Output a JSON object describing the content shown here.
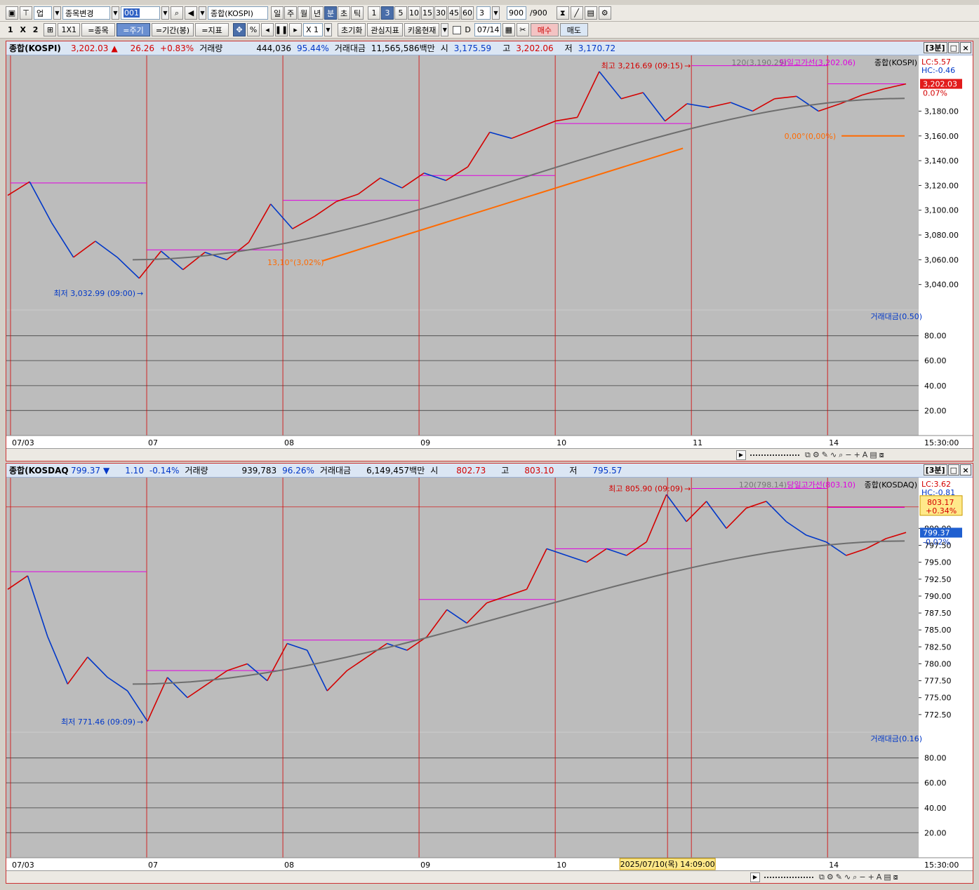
{
  "toolbar1": {
    "gubun": "업",
    "stock_change": "종목변경",
    "code": "001",
    "index_name": "종합(KOSPI)",
    "periods": [
      "일",
      "주",
      "월",
      "년",
      "분",
      "초",
      "틱"
    ],
    "active_period": "분",
    "intervals": [
      "1",
      "3",
      "5",
      "10",
      "15",
      "30",
      "45",
      "60"
    ],
    "active_interval": "3",
    "interval_value": "3",
    "count": "900",
    "count_total": "/900"
  },
  "toolbar2": {
    "layout": "1 X 2",
    "one_by_one": "1X1",
    "item_btn": "=종목",
    "period_btn": "=주기",
    "range_btn": "=기간(봉)",
    "indicator_btn": "=지표",
    "percent": "%",
    "zoom": "X 1",
    "reset": "초기화",
    "interest": "관심지표",
    "kiwoom": "키움현재",
    "date_label": "D",
    "date": "07/14",
    "buy": "매수",
    "sell": "매도"
  },
  "panels": [
    {
      "name": "종합(KOSPI)",
      "price": "3,202.03",
      "arrow": "▲",
      "change": "26.26",
      "change_pct": "+0.83%",
      "volume_label": "거래량",
      "volume": "444,036",
      "volume_pct": "95.44%",
      "amount_label": "거래대금",
      "amount": "11,565,586백만",
      "open_label": "시",
      "open": "3,175.59",
      "high_label": "고",
      "high": "3,202.06",
      "low_label": "저",
      "low": "3,170.72",
      "interval_tag": "[3분]",
      "lc": "LC:5.57",
      "hc": "HC:-0.46",
      "ma_label": "120(3,190.29)",
      "day_high_label": "당일고가선(3,202.06)",
      "series_label": "종합(KOSPI)",
      "max_label": "최고 3,216.69 (09:15)",
      "min_label": "최저 3,032.99 (09:00)",
      "trend_label": "0,00°(0,00%)",
      "trend_label2": "13,10°(3,02%)",
      "last_price_tag": "3,202.03",
      "last_pct_tag": "0.07%",
      "sub_label": "거래대금(0.50)",
      "y_ticks": [
        "3,180.00",
        "3,160.00",
        "3,140.00",
        "3,120.00",
        "3,100.00",
        "3,080.00",
        "3,060.00",
        "3,040.00"
      ],
      "sub_ticks": [
        "80.00",
        "60.00",
        "40.00",
        "20.00"
      ],
      "x_labels": [
        "07/03",
        "07",
        "08",
        "09",
        "10",
        "11",
        "14"
      ],
      "time_label": "15:30:00"
    },
    {
      "name": "종합(KOSDAQ",
      "price": "799.37",
      "arrow": "▼",
      "change": "1.10",
      "change_pct": "-0.14%",
      "volume_label": "거래량",
      "volume": "939,783",
      "volume_pct": "96.26%",
      "amount_label": "거래대금",
      "amount": "6,149,457백만",
      "open_label": "시",
      "open": "802.73",
      "high_label": "고",
      "high": "803.10",
      "low_label": "저",
      "low": "795.57",
      "interval_tag": "[3분]",
      "lc": "LC:3.62",
      "hc": "HC:-0.81",
      "ma_label": "120(798.14)",
      "day_high_label": "당일고가선(803.10)",
      "series_label": "종합(KOSDAQ)",
      "max_label": "최고 805.90 (09:09)",
      "min_label": "최저 771.46 (09:09)",
      "high_tag": "803.17",
      "high_tag_pct": "+0.34%",
      "last_price_tag": "799.37",
      "last_pct_tag": "-0.02%",
      "sub_label": "거래대금(0.16)",
      "y_ticks": [
        "800.00",
        "797.50",
        "795.00",
        "792.50",
        "790.00",
        "787.50",
        "785.00",
        "782.50",
        "780.00",
        "777.50",
        "775.00",
        "772.50"
      ],
      "sub_ticks": [
        "80.00",
        "60.00",
        "40.00",
        "20.00"
      ],
      "x_labels": [
        "07/03",
        "07",
        "08",
        "09",
        "10",
        "14"
      ],
      "cursor_label": "2025/07/10(목) 14:09:00",
      "time_label": "15:30:00"
    }
  ],
  "colors": {
    "price_up": "#d40000",
    "price_down": "#0037c8",
    "ma_line": "#6e6e6e",
    "day_high_line": "#e000e0",
    "trend_line": "#ff6a00",
    "chart_bg": "#bcbcbc"
  },
  "chart_data": [
    {
      "type": "line",
      "title": "종합(KOSPI)",
      "days": [
        "07/03",
        "07",
        "08",
        "09",
        "10",
        "11",
        "14"
      ],
      "day_high": [
        3122,
        3068,
        3108,
        3128,
        3170,
        3216.69,
        3202.06
      ],
      "day_low": [
        3055,
        3032.99,
        3075,
        3100,
        3132,
        3170,
        3170.72
      ],
      "close_path": [
        3112,
        3123,
        3090,
        3062,
        3075,
        3062,
        3045,
        3067,
        3052,
        3066,
        3060,
        3074,
        3105,
        3085,
        3095,
        3107,
        3113,
        3126,
        3118,
        3130,
        3124,
        3135,
        3163,
        3158,
        3165,
        3172,
        3175,
        3212,
        3190,
        3195,
        3172,
        3186,
        3183,
        3187,
        3180,
        3190,
        3192,
        3180,
        3186,
        3193,
        3198,
        3202
      ],
      "ma120_range": [
        3060,
        3190.29
      ],
      "ylim": [
        3020,
        3225
      ]
    },
    {
      "type": "line",
      "title": "종합(KOSDAQ)",
      "days": [
        "07/03",
        "07",
        "08",
        "09",
        "10",
        "11",
        "14"
      ],
      "day_high": [
        793.6,
        779,
        783.5,
        789.5,
        797,
        805.9,
        803.1
      ],
      "day_low": [
        776,
        771.46,
        775.5,
        783,
        789,
        797,
        795.57
      ],
      "close_path": [
        791,
        793,
        784,
        777,
        781,
        778,
        776,
        771.5,
        778,
        775,
        777,
        779,
        780,
        777.5,
        783,
        782,
        776,
        779,
        781,
        783,
        782,
        784,
        788,
        786,
        789,
        790,
        791,
        797,
        796,
        795,
        797,
        796,
        798,
        805,
        801,
        804,
        800,
        803,
        804,
        801,
        799,
        798,
        796,
        797,
        798.5,
        799.4
      ],
      "ma120_range": [
        777,
        798.14
      ],
      "ylim": [
        770,
        807.5
      ]
    }
  ]
}
